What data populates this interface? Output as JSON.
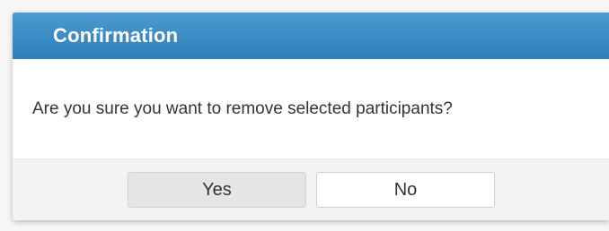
{
  "dialog": {
    "title": "Confirmation",
    "message": "Are you sure you want to remove selected participants?",
    "buttons": {
      "yes_label": "Yes",
      "no_label": "No"
    }
  },
  "colors": {
    "titlebar": "#3a8cc8",
    "title_text": "#ffffff",
    "footer_bg": "#f3f3f3",
    "yes_bg": "#e5e5e5",
    "no_bg": "#ffffff"
  }
}
